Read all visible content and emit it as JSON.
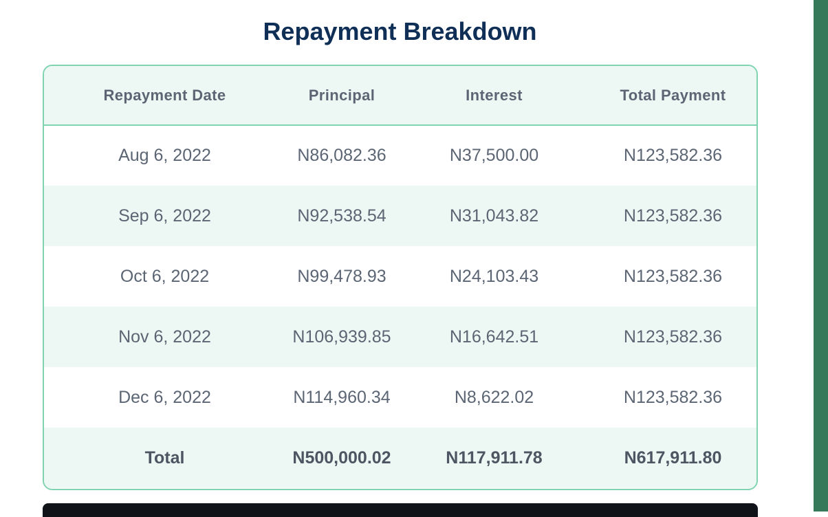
{
  "title": "Repayment Breakdown",
  "table": {
    "headers": [
      "Repayment Date",
      "Principal",
      "Interest",
      "Total Payment"
    ],
    "rows": [
      [
        "Aug 6, 2022",
        "N86,082.36",
        "N37,500.00",
        "N123,582.36"
      ],
      [
        "Sep 6, 2022",
        "N92,538.54",
        "N31,043.82",
        "N123,582.36"
      ],
      [
        "Oct 6, 2022",
        "N99,478.93",
        "N24,103.43",
        "N123,582.36"
      ],
      [
        "Nov 6, 2022",
        "N106,939.85",
        "N16,642.51",
        "N123,582.36"
      ],
      [
        "Dec 6, 2022",
        "N114,960.34",
        "N8,622.02",
        "N123,582.36"
      ]
    ],
    "total": [
      "Total",
      "N500,000.02",
      "N117,911.78",
      "N617,911.80"
    ]
  },
  "colors": {
    "title": "#0f2f57",
    "border": "#7fd3b1",
    "row_alt": "#edf8f4",
    "text": "#5b6573",
    "side_strip": "#36795a"
  }
}
